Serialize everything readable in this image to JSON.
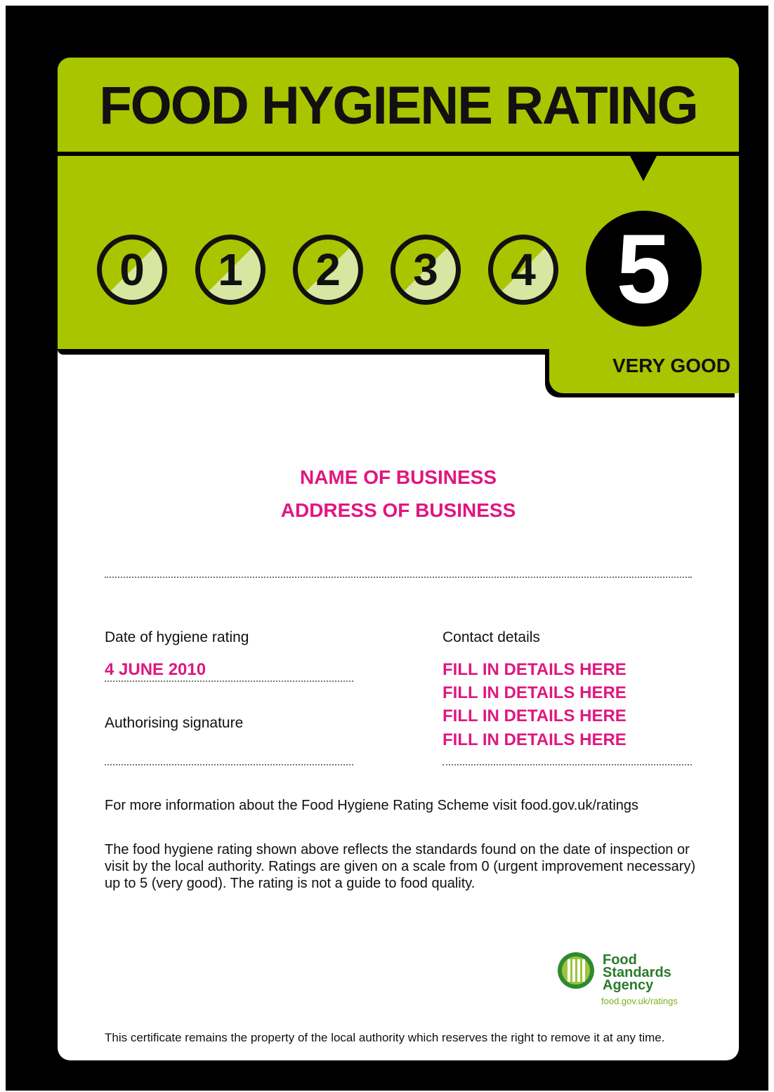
{
  "certificate": {
    "title": "FOOD HYGIENE RATING",
    "scale": [
      "0",
      "1",
      "2",
      "3",
      "4",
      "5"
    ],
    "rating": "5",
    "rating_label": "VERY GOOD",
    "business_name": "NAME OF BUSINESS",
    "business_address": "ADDRESS OF BUSINESS",
    "date_label": "Date of hygiene rating",
    "date_value": "4 JUNE 2010",
    "signature_label": "Authorising signature",
    "contact_label": "Contact details",
    "contact_lines": [
      "FILL IN DETAILS HERE",
      "FILL IN DETAILS HERE",
      "FILL IN DETAILS HERE",
      "FILL IN DETAILS HERE"
    ],
    "info_text": "For more information about the Food Hygiene Rating Scheme visit food.gov.uk/ratings",
    "disclaimer": "The food hygiene rating shown above reflects the standards found on the date of inspection or visit by the local authority. Ratings are given on a scale from 0 (urgent improvement necessary) up to 5 (very good). The rating is not a guide to food quality.",
    "footer": "This certificate remains the property of the local authority which reserves the right to remove it at any time."
  },
  "logo": {
    "name_line1": "Food",
    "name_line2": "Standards",
    "name_line3": "Agency",
    "url": "food.gov.uk/ratings"
  },
  "colors": {
    "green": "#a9c500",
    "pink": "#e0177f",
    "black": "#000000"
  }
}
